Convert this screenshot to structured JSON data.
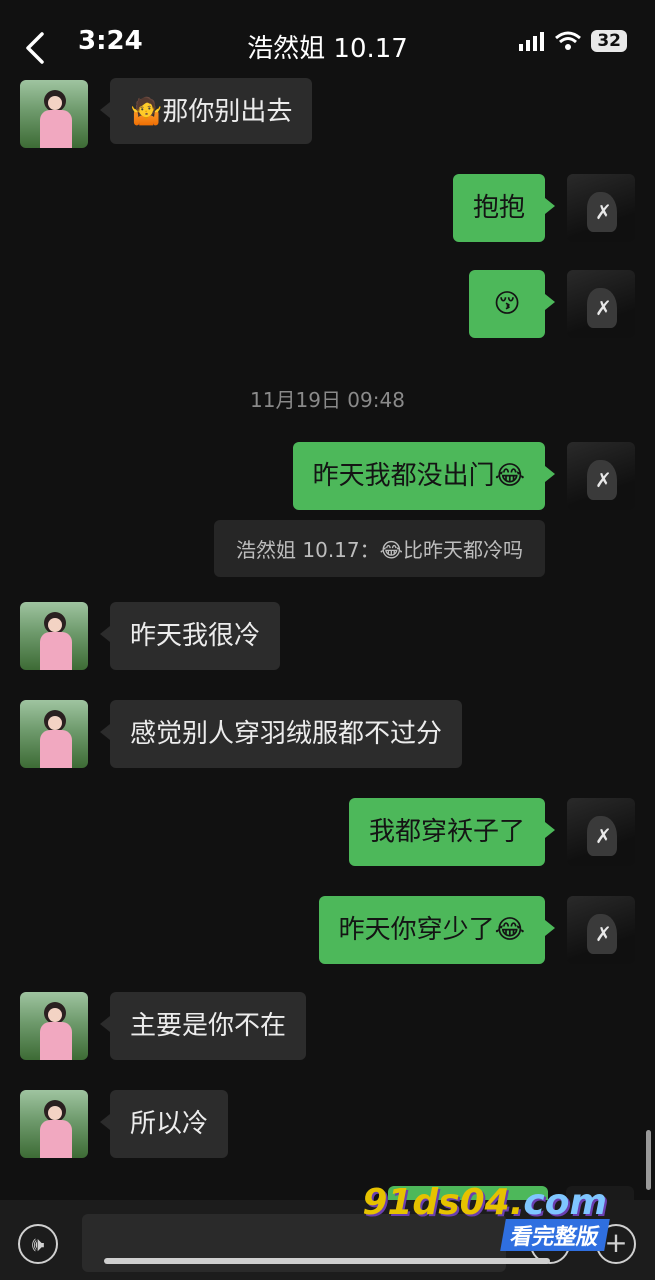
{
  "status_bar": {
    "time": "3:24",
    "battery": "32"
  },
  "header": {
    "title": "浩然姐 10.17"
  },
  "messages": [
    {
      "side": "left",
      "text": "那你别出去",
      "emoji": "🤷"
    },
    {
      "side": "right",
      "text": "抱抱"
    },
    {
      "side": "right",
      "text": "",
      "emoji": "😚"
    },
    {
      "side": "right",
      "text": "昨天我都没出门",
      "emoji": "😂"
    },
    {
      "side": "left",
      "text": "昨天我很冷"
    },
    {
      "side": "left",
      "text": "感觉别人穿羽绒服都不过分"
    },
    {
      "side": "right",
      "text": "我都穿袄子了"
    },
    {
      "side": "right",
      "text": "昨天你穿少了",
      "emoji": "😂"
    },
    {
      "side": "left",
      "text": "主要是你不在"
    },
    {
      "side": "left",
      "text": "所以冷"
    }
  ],
  "timestamp": "11月19日 09:48",
  "quote": {
    "text": "浩然姐 10.17：😂比昨天都冷吗"
  },
  "watermark": {
    "url_prefix": "91ds04.",
    "url_suffix": "com",
    "label": "看完整版"
  },
  "icons": {
    "back": "chevron-left-icon",
    "signal": "signal-icon",
    "wifi": "wifi-icon",
    "voice": "voice-icon",
    "emoji": "emoji-icon",
    "plus": "plus-icon"
  }
}
